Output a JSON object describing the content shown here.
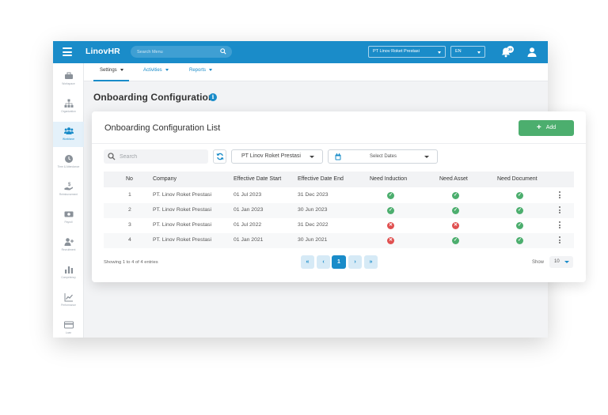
{
  "app": {
    "logo_text": "LinovHR"
  },
  "topbar": {
    "search_placeholder": "Search Menu",
    "company": "PT Linov Roket Prestasi",
    "language": "EN",
    "notification_count": "30",
    "accent_color": "#1a8cc9"
  },
  "sidebar": {
    "items": [
      {
        "label": "Workspace",
        "icon": "briefcase-icon"
      },
      {
        "label": "Organization",
        "icon": "org-chart-icon"
      },
      {
        "label": "Workforce",
        "icon": "people-icon",
        "active": true
      },
      {
        "label": "Time & Attendance",
        "icon": "clock-icon"
      },
      {
        "label": "Reimbursement",
        "icon": "money-hand-icon"
      },
      {
        "label": "Payroll",
        "icon": "cash-icon"
      },
      {
        "label": "Recruitment",
        "icon": "add-person-icon"
      },
      {
        "label": "Competency",
        "icon": "bar-chart-icon"
      },
      {
        "label": "Performance",
        "icon": "trend-icon"
      },
      {
        "label": "Loan",
        "icon": "card-icon"
      }
    ]
  },
  "subnav": {
    "tabs": [
      {
        "label": "Settings",
        "active": true
      },
      {
        "label": "Activities"
      },
      {
        "label": "Reports"
      }
    ]
  },
  "page": {
    "title": "Onboarding Configuration",
    "info": "i"
  },
  "card": {
    "title": "Onboarding Configuration List",
    "add_label": "Add",
    "add_color": "#4cae6e",
    "search_placeholder": "Search",
    "company_filter": "PT Linov Roket Prestasi",
    "date_placeholder": "Select Dates"
  },
  "table": {
    "headers": [
      "No",
      "Company",
      "Effective Date Start",
      "Effective Date End",
      "Need Induction",
      "Need Asset",
      "Need Document"
    ],
    "rows": [
      {
        "no": "1",
        "company": "PT. Linov Roket Prestasi",
        "start": "01 Jul 2023",
        "end": "31 Dec 2023",
        "induction": true,
        "asset": true,
        "document": true
      },
      {
        "no": "2",
        "company": "PT. Linov Roket Prestasi",
        "start": "01 Jan 2023",
        "end": "30 Jun 2023",
        "induction": true,
        "asset": true,
        "document": true
      },
      {
        "no": "3",
        "company": "PT. Linov Roket Prestasi",
        "start": "01 Jul 2022",
        "end": "31 Dec 2022",
        "induction": false,
        "asset": false,
        "document": true
      },
      {
        "no": "4",
        "company": "PT. Linov Roket Prestasi",
        "start": "01 Jan 2021",
        "end": "30 Jun 2021",
        "induction": false,
        "asset": true,
        "document": true
      }
    ]
  },
  "pagination": {
    "summary": "Showing 1 to 4 of 4 entries",
    "first": "«",
    "prev": "‹",
    "current": "1",
    "next": "›",
    "last": "»",
    "show_label": "Show",
    "page_size": "10"
  }
}
